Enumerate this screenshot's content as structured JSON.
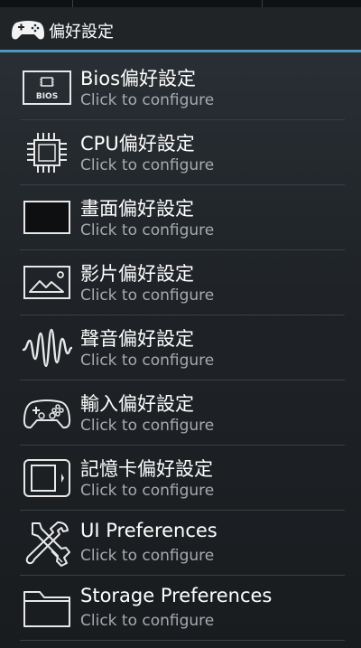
{
  "header": {
    "title": "偏好設定",
    "app_icon": "gamepad-icon",
    "accent_color": "#4a9bc0"
  },
  "items": [
    {
      "label": "Bios偏好設定",
      "subtitle": "Click to configure",
      "icon": "bios-chip-icon",
      "bios_text": "BIOS"
    },
    {
      "label": "CPU偏好設定",
      "subtitle": "Click to configure",
      "icon": "cpu-icon"
    },
    {
      "label": "畫面偏好設定",
      "subtitle": "Click to configure",
      "icon": "screen-icon"
    },
    {
      "label": "影片偏好設定",
      "subtitle": "Click to configure",
      "icon": "image-icon"
    },
    {
      "label": "聲音偏好設定",
      "subtitle": "Click to configure",
      "icon": "sound-wave-icon"
    },
    {
      "label": "輸入偏好設定",
      "subtitle": "Click to configure",
      "icon": "controller-icon"
    },
    {
      "label": "記憶卡偏好設定",
      "subtitle": "Click to configure",
      "icon": "memory-card-icon"
    },
    {
      "label": "UI Preferences",
      "subtitle": "Click to configure",
      "icon": "tools-icon"
    },
    {
      "label": "Storage Preferences",
      "subtitle": "Click to configure",
      "icon": "folder-icon"
    }
  ]
}
